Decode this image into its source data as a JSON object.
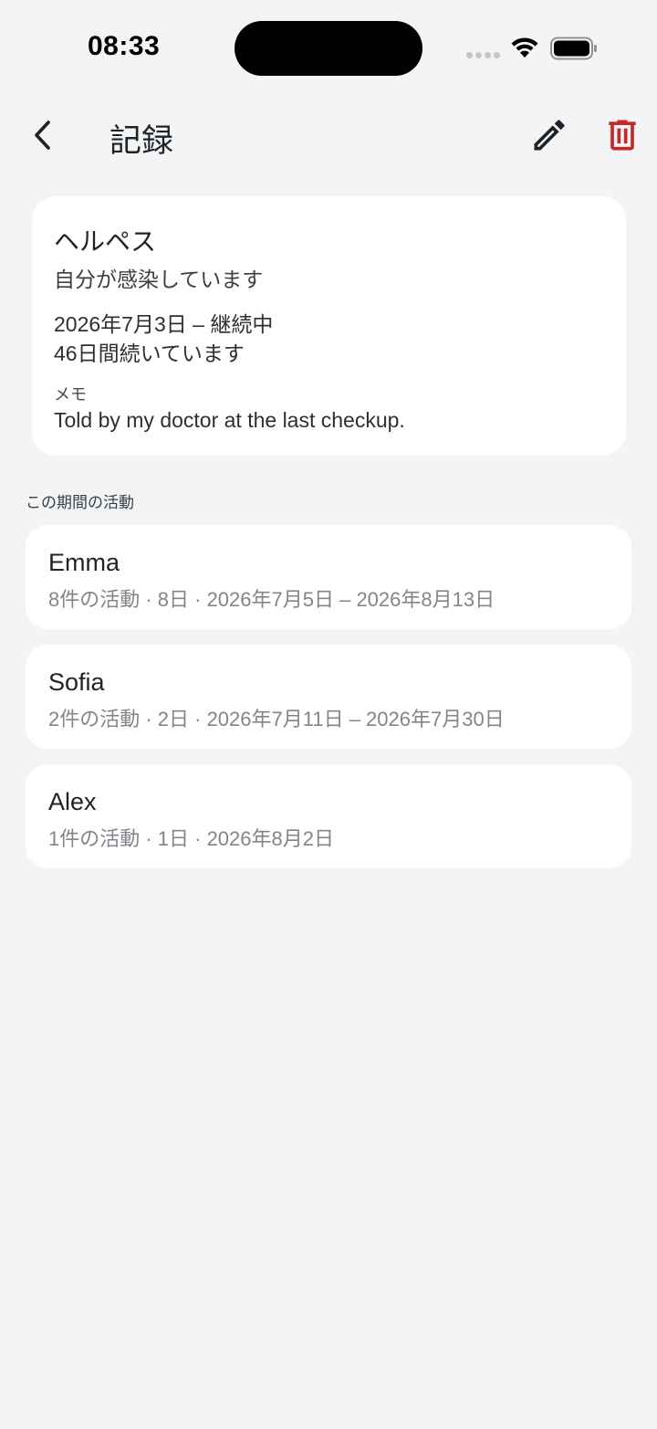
{
  "status_bar": {
    "time": "08:33"
  },
  "header": {
    "title": "記録",
    "back_icon": "chevron-left-icon",
    "edit_icon": "pencil-icon",
    "delete_icon": "trash-icon",
    "delete_color": "#c62828"
  },
  "record": {
    "name": "ヘルペス",
    "status": "自分が感染しています",
    "date_range": "2026年7月3日 – 継続中",
    "duration": "46日間続いています",
    "memo_label": "メモ",
    "memo": "Told by my doctor at the last checkup."
  },
  "activity_section": {
    "label": "この期間の活動",
    "items": [
      {
        "name": "Emma",
        "summary": "8件の活動 · 8日 · 2026年7月5日 – 2026年8月13日"
      },
      {
        "name": "Sofia",
        "summary": "2件の活動 · 2日 · 2026年7月11日 – 2026年7月30日"
      },
      {
        "name": "Alex",
        "summary": "1件の活動 · 1日 · 2026年8月2日"
      }
    ]
  }
}
